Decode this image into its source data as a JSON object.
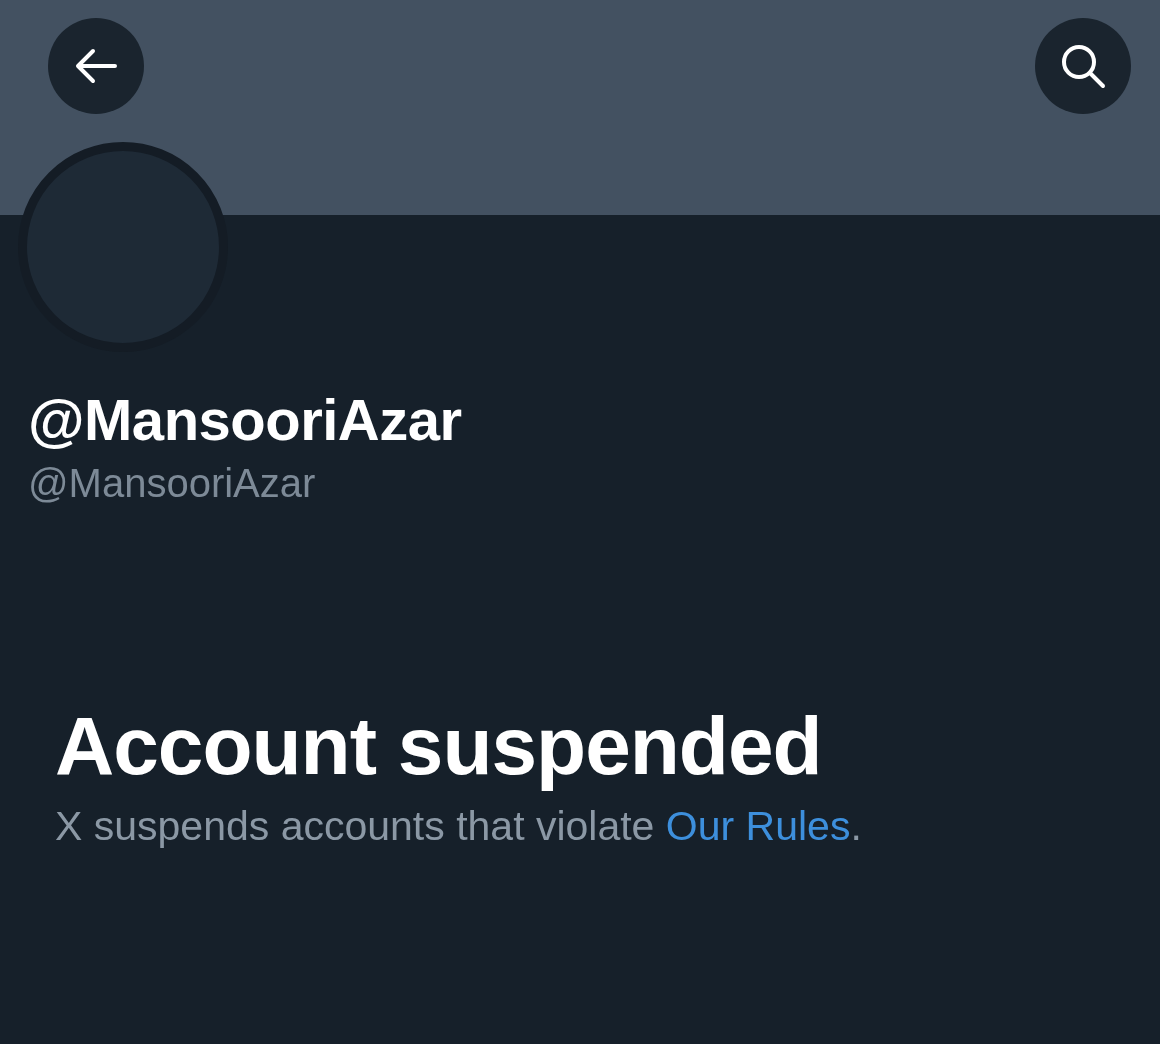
{
  "profile": {
    "display_name": "@MansooriAzar",
    "handle": "@MansooriAzar"
  },
  "notice": {
    "title": "Account suspended",
    "text": "X suspends accounts that violate ",
    "link": "Our Rules",
    "text_after": "."
  }
}
